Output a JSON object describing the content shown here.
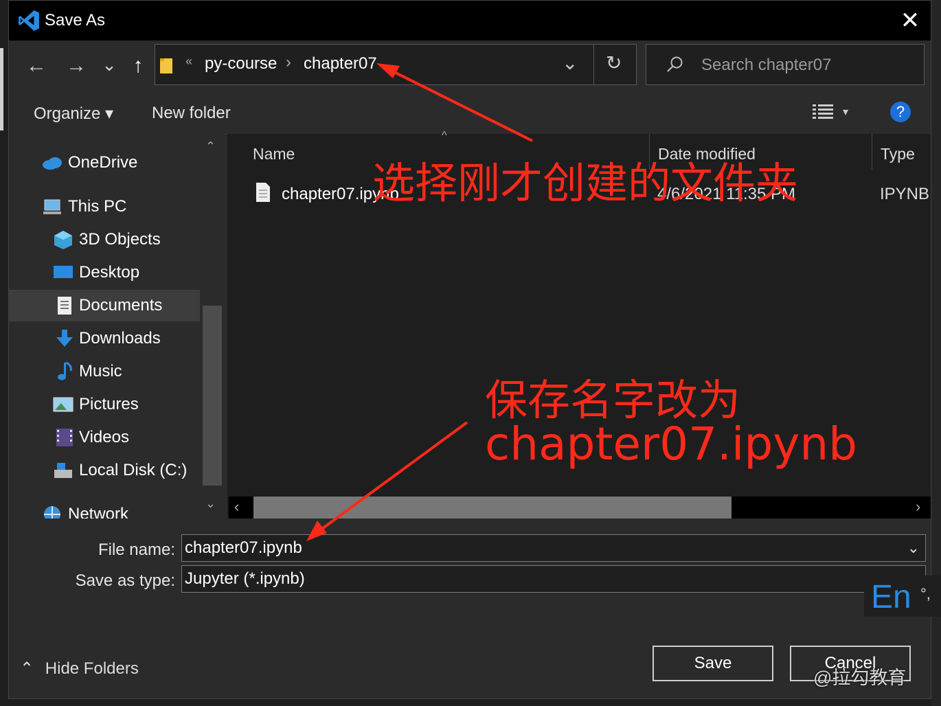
{
  "window": {
    "title": "Save As",
    "close_glyph": "✕",
    "app_icon": "vscode-icon"
  },
  "nav": {
    "back": "←",
    "forward": "→",
    "recent": "⌄",
    "up": "↑",
    "breadcrumb": {
      "overflow": "«",
      "items": [
        "py-course",
        "chapter07"
      ],
      "separator": "›"
    },
    "dropdown": "⌄",
    "refresh": "↻",
    "search_placeholder": "Search chapter07"
  },
  "toolbar": {
    "organize": "Organize ▾",
    "new_folder": "New folder",
    "view_icon": "details-view-icon",
    "view_arrow": "▾",
    "help": "?"
  },
  "sidebar": {
    "items": [
      {
        "label": "OneDrive",
        "icon": "onedrive-icon"
      },
      {
        "label": "This PC",
        "icon": "this-pc-icon"
      },
      {
        "label": "3D Objects",
        "icon": "3d-objects-icon"
      },
      {
        "label": "Desktop",
        "icon": "desktop-icon"
      },
      {
        "label": "Documents",
        "icon": "documents-icon",
        "selected": true
      },
      {
        "label": "Downloads",
        "icon": "downloads-icon"
      },
      {
        "label": "Music",
        "icon": "music-icon"
      },
      {
        "label": "Pictures",
        "icon": "pictures-icon"
      },
      {
        "label": "Videos",
        "icon": "videos-icon"
      },
      {
        "label": "Local Disk (C:)",
        "icon": "disk-icon"
      },
      {
        "label": "Network",
        "icon": "network-icon"
      }
    ],
    "scroll_up": "⌃",
    "scroll_down": "⌄"
  },
  "list": {
    "columns": [
      "Name",
      "Date modified",
      "Type"
    ],
    "sort_indicator": "^",
    "rows": [
      {
        "name": "chapter07.ipynb",
        "date": "4/6/2021 11:35 PM",
        "type": "IPYNB F"
      }
    ],
    "hscroll_left": "‹",
    "hscroll_right": "›"
  },
  "form": {
    "filename_label": "File name:",
    "filename_value": "chapter07.ipynb",
    "type_label": "Save as type:",
    "type_value": "Jupyter (*.ipynb)",
    "dropdown": "⌄"
  },
  "footer": {
    "hide_folders_glyph": "⌃",
    "hide_folders": "Hide Folders",
    "save": "Save",
    "cancel": "Cancel"
  },
  "annotations": {
    "select_folder": "选择刚才创建的文件夹",
    "rename_line1": "保存名字改为",
    "rename_line2": "chapter07.ipynb"
  },
  "overlay": {
    "ime": "En",
    "ime_dot": "°,",
    "watermark": "@拉勾教育"
  },
  "colors": {
    "annotation": "#ff2a1a",
    "help": "#1e6fd9",
    "vscode": "#2a8ae0"
  }
}
